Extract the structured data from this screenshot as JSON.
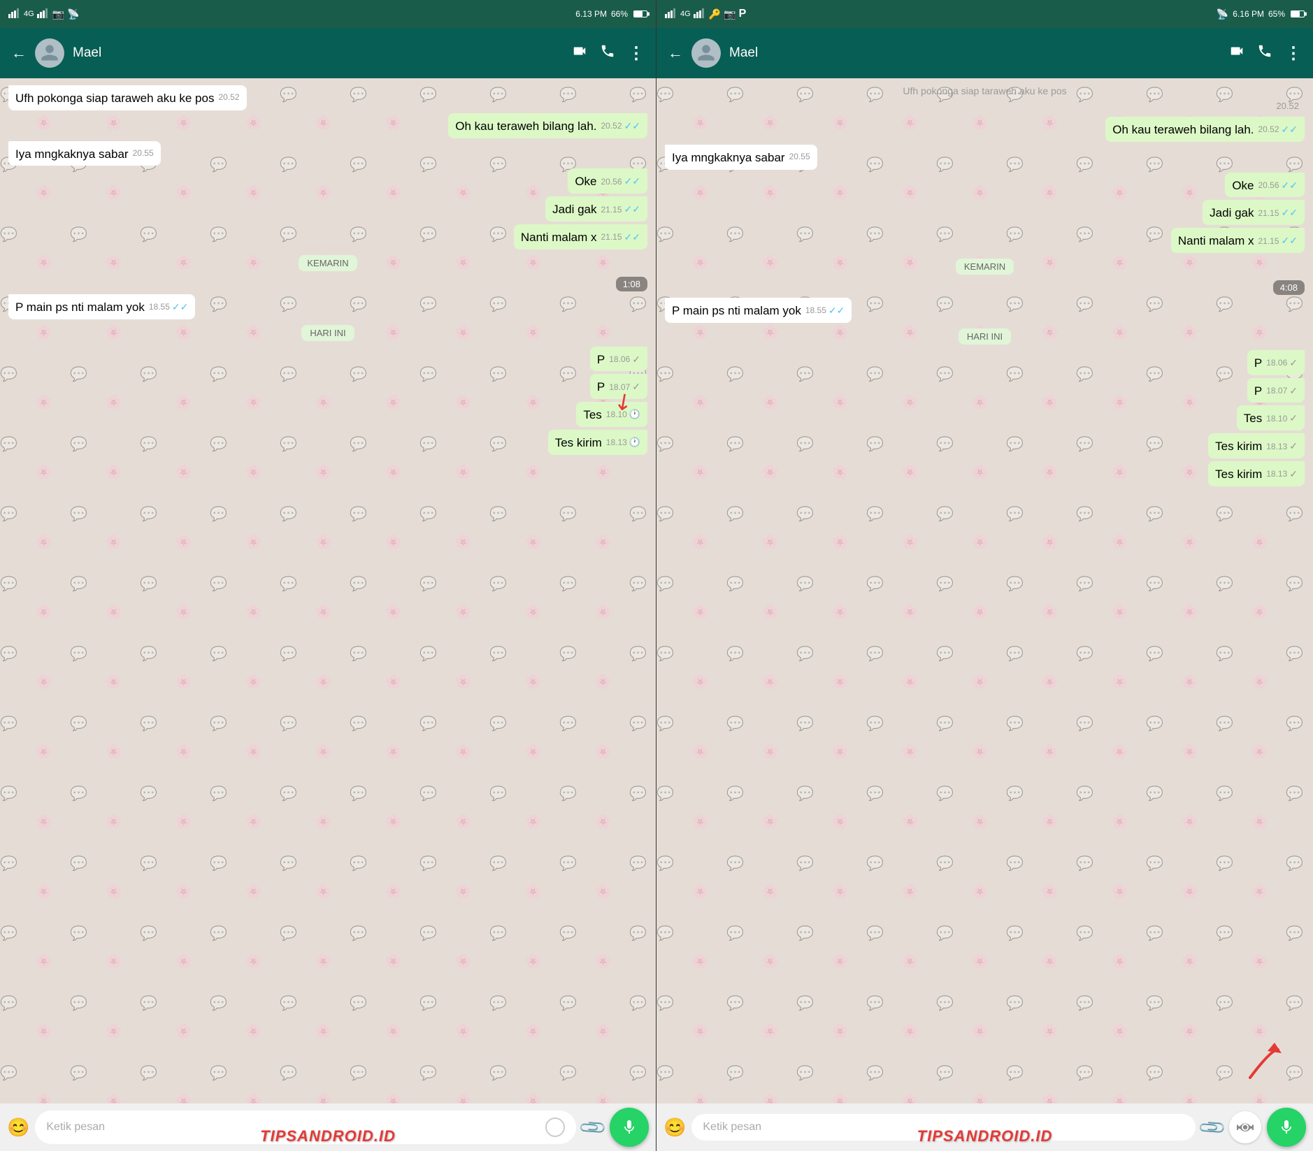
{
  "screens": [
    {
      "id": "left",
      "status_bar": {
        "left": "4G  ₂",
        "time": "6.13 PM",
        "battery": "66%",
        "wifi": true,
        "cast": true
      },
      "header": {
        "contact_name": "Mael",
        "back_label": "←",
        "video_icon": "📹",
        "call_icon": "📞",
        "menu_icon": "⋮"
      },
      "messages": [
        {
          "type": "received",
          "text": "Ufh pokonga siap taraweh aku ke pos",
          "time": "20.52",
          "tick": ""
        },
        {
          "type": "sent",
          "text": "Oh kau teraweh bilang lah.",
          "time": "20.52",
          "tick": "✓✓"
        },
        {
          "type": "received",
          "text": "Iya mngkaknya sabar",
          "time": "20.55",
          "tick": ""
        },
        {
          "type": "sent",
          "text": "Oke",
          "time": "20.56",
          "tick": "✓✓"
        },
        {
          "type": "sent",
          "text": "Jadi gak",
          "time": "21.15",
          "tick": "✓✓"
        },
        {
          "type": "sent",
          "text": "Nanti malam x",
          "time": "21.15",
          "tick": "✓✓"
        },
        {
          "type": "divider",
          "text": "KEMARIN"
        },
        {
          "type": "time-divider",
          "text": "1:08"
        },
        {
          "type": "received",
          "text": "P main ps nti malam yok",
          "time": "18.55",
          "tick": "✓✓"
        },
        {
          "type": "divider",
          "text": "HARI INI"
        },
        {
          "type": "sent",
          "text": "P",
          "time": "18.06",
          "tick": "✓"
        },
        {
          "type": "sent",
          "text": "P",
          "time": "18.07",
          "tick": "✓"
        },
        {
          "type": "sent",
          "text": "Tes",
          "time": "18.10",
          "tick": "🕐",
          "pending": true
        },
        {
          "type": "sent",
          "text": "Tes kirim",
          "time": "18.13",
          "tick": "🕐",
          "pending": true
        }
      ],
      "input": {
        "placeholder": "Ketik pesan",
        "emoji": "😊",
        "attach": "📎",
        "mic": "🎤",
        "mic_color": "#075e54",
        "fab_icon": "🎤"
      },
      "branding": "TIPSANDROID.ID"
    },
    {
      "id": "right",
      "status_bar": {
        "left": "4G  ₂ 🔑",
        "time": "6.16 PM",
        "battery": "65%",
        "wifi": true,
        "cast": true
      },
      "header": {
        "contact_name": "Mael",
        "back_label": "←",
        "video_icon": "📹",
        "call_icon": "📞",
        "menu_icon": "⋮"
      },
      "messages": [
        {
          "type": "partial",
          "text": "Ufh pokonga siap taraweh aku ke pos"
        },
        {
          "type": "partial-time",
          "text": "20.52"
        },
        {
          "type": "sent",
          "text": "Oh kau teraweh bilang lah.",
          "time": "20.52",
          "tick": "✓✓"
        },
        {
          "type": "received",
          "text": "Iya mngkaknya sabar",
          "time": "20.55",
          "tick": ""
        },
        {
          "type": "sent",
          "text": "Oke",
          "time": "20.56",
          "tick": "✓✓"
        },
        {
          "type": "sent",
          "text": "Jadi gak",
          "time": "21.15",
          "tick": "✓✓"
        },
        {
          "type": "sent",
          "text": "Nanti malam x",
          "time": "21.15",
          "tick": "✓✓"
        },
        {
          "type": "divider",
          "text": "KEMARIN"
        },
        {
          "type": "time-divider",
          "text": "4:08"
        },
        {
          "type": "received",
          "text": "P main ps nti malam yok",
          "time": "18.55",
          "tick": "✓✓"
        },
        {
          "type": "divider",
          "text": "HARI INI"
        },
        {
          "type": "sent",
          "text": "P",
          "time": "18.06",
          "tick": "✓"
        },
        {
          "type": "sent",
          "text": "P",
          "time": "18.07",
          "tick": "✓"
        },
        {
          "type": "sent",
          "text": "Tes",
          "time": "18.10",
          "tick": "✓"
        },
        {
          "type": "sent",
          "text": "Tes kirim",
          "time": "18.13",
          "tick": "✓"
        },
        {
          "type": "sent",
          "text": "Tes kirim",
          "time": "18.13",
          "tick": "✓"
        }
      ],
      "input": {
        "placeholder": "Ketik pesan",
        "emoji": "😊",
        "attach": "📎",
        "camera": "📷",
        "mic": "🎤",
        "mic_color": "#25d366",
        "fab_icon": "🎤"
      },
      "branding": "TIPSANDROID.ID"
    }
  ]
}
